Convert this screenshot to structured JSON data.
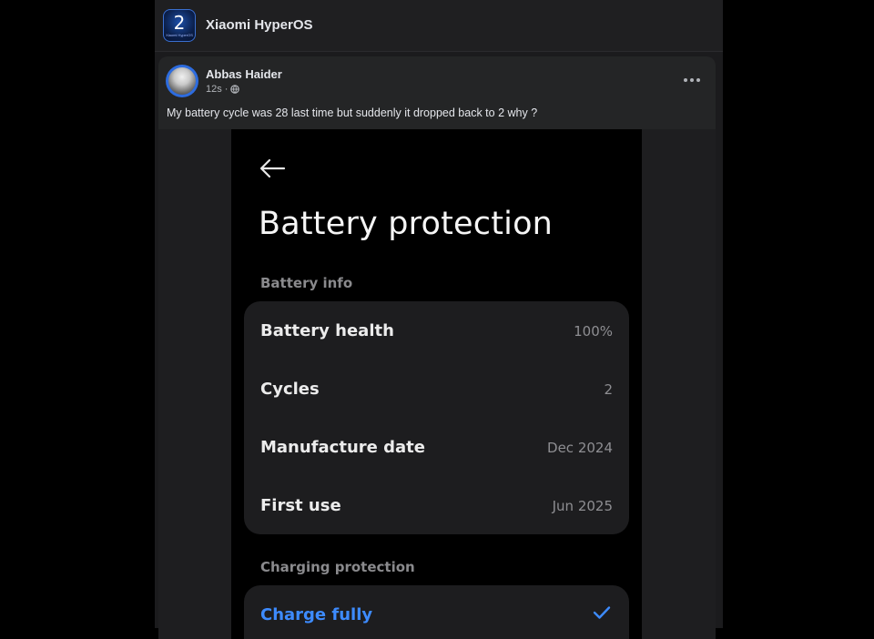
{
  "group": {
    "icon_text": "2",
    "icon_subtext": "Xiaomi HyperOS",
    "name": "Xiaomi HyperOS"
  },
  "post": {
    "author": "Abbas Haider",
    "time": "12s",
    "separator": "·",
    "privacy_icon": "globe-icon",
    "more_icon": "more-options-icon",
    "caption": "My battery cycle was 28 last time but suddenly it dropped back to 2 why ?"
  },
  "screenshot": {
    "back_icon": "back-arrow-icon",
    "title": "Battery protection",
    "battery_info": {
      "label": "Battery info",
      "rows": [
        {
          "label": "Battery health",
          "value": "100%"
        },
        {
          "label": "Cycles",
          "value": "2"
        },
        {
          "label": "Manufacture date",
          "value": "Dec 2024"
        },
        {
          "label": "First use",
          "value": "Jun 2025"
        }
      ]
    },
    "charging_protection": {
      "label": "Charging protection",
      "rows": [
        {
          "label": "Charge fully",
          "selected": true,
          "icon": "checkmark-icon"
        }
      ]
    }
  },
  "colors": {
    "page_bg": "#000000",
    "column_bg": "#1b1b1d",
    "post_bg": "#242526",
    "text_primary": "#e4e6eb",
    "text_secondary": "#b0b3b8",
    "accent": "#3d8bff",
    "card_bg": "#1d1d1f"
  }
}
